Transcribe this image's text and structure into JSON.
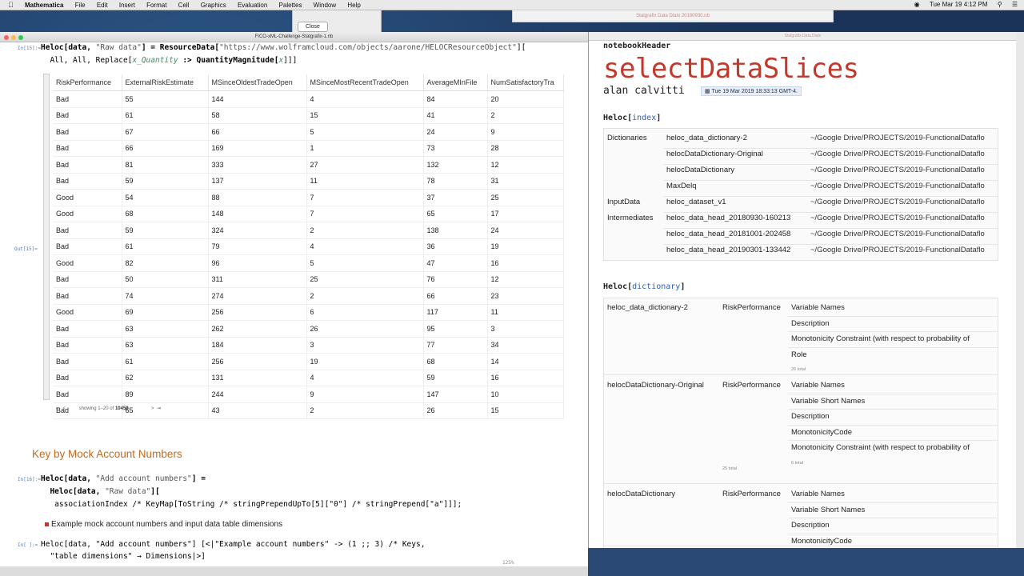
{
  "menubar": {
    "app": "Mathematica",
    "items": [
      "File",
      "Edit",
      "Insert",
      "Format",
      "Cell",
      "Graphics",
      "Evaluation",
      "Palettes",
      "Window",
      "Help"
    ],
    "clock": "Tue Mar 19  4:12 PM"
  },
  "bg_dialog": {
    "close_label": "Close"
  },
  "bg_window": {
    "title": "Statgrafix Data Dialo  20180930.nb"
  },
  "left_notebook": {
    "title": "FICO-xML-Challenge-Statgrafix-1.nb",
    "in15_label": "In[15]:=",
    "out15_label": "Out[15]=",
    "in16_label": "In[16]:=",
    "code15_line1_a": "Heloc[data, ",
    "code15_line1_str": "\"Raw data\"",
    "code15_line1_b": "] = ResourceData[",
    "code15_line1_url": "\"https://www.wolframcloud.com/objects/aarone/HELOCResourceObject\"",
    "code15_line1_c": "][",
    "code15_line2_a": "  All, All, Replace[",
    "code15_line2_it": "x_Quantity",
    "code15_line2_b": " :> QuantityMagnitude[",
    "code15_line2_it2": "x",
    "code15_line2_c": "]]]",
    "table": {
      "columns": [
        "RiskPerformance",
        "ExternalRiskEstimate",
        "MSinceOldestTradeOpen",
        "MSinceMostRecentTradeOpen",
        "AverageMInFile",
        "NumSatisfactoryTra"
      ],
      "rows": [
        [
          "Bad",
          "55",
          "144",
          "4",
          "84",
          "20"
        ],
        [
          "Bad",
          "61",
          "58",
          "15",
          "41",
          "2"
        ],
        [
          "Bad",
          "67",
          "66",
          "5",
          "24",
          "9"
        ],
        [
          "Bad",
          "66",
          "169",
          "1",
          "73",
          "28"
        ],
        [
          "Bad",
          "81",
          "333",
          "27",
          "132",
          "12"
        ],
        [
          "Bad",
          "59",
          "137",
          "11",
          "78",
          "31"
        ],
        [
          "Good",
          "54",
          "88",
          "7",
          "37",
          "25"
        ],
        [
          "Good",
          "68",
          "148",
          "7",
          "65",
          "17"
        ],
        [
          "Bad",
          "59",
          "324",
          "2",
          "138",
          "24"
        ],
        [
          "Bad",
          "61",
          "79",
          "4",
          "36",
          "19"
        ],
        [
          "Good",
          "82",
          "96",
          "5",
          "47",
          "16"
        ],
        [
          "Bad",
          "50",
          "311",
          "25",
          "76",
          "12"
        ],
        [
          "Bad",
          "74",
          "274",
          "2",
          "66",
          "23"
        ],
        [
          "Good",
          "69",
          "256",
          "6",
          "117",
          "11"
        ],
        [
          "Bad",
          "63",
          "262",
          "26",
          "95",
          "3"
        ],
        [
          "Bad",
          "63",
          "184",
          "3",
          "77",
          "34"
        ],
        [
          "Bad",
          "61",
          "256",
          "19",
          "68",
          "14"
        ],
        [
          "Bad",
          "62",
          "131",
          "4",
          "59",
          "16"
        ],
        [
          "Bad",
          "89",
          "244",
          "9",
          "147",
          "10"
        ],
        [
          "Bad",
          "65",
          "43",
          "2",
          "26",
          "15"
        ]
      ],
      "paging_prefix": "showing 1–20 of ",
      "paging_total": "10459"
    },
    "section_title": "Key by Mock Account Numbers",
    "code16_line1_a": "Heloc[data, ",
    "code16_line1_str": "\"Add account numbers\"",
    "code16_line1_b": "] =",
    "code16_line2_a": "  Heloc[data, ",
    "code16_line2_str": "\"Raw data\"",
    "code16_line2_b": "][",
    "code16_line3": "   associationIndex /* KeyMap[ToString /* stringPrependUpTo[5][\"0\"] /* stringPrepend[\"a\"]]];",
    "bullet_text": "Example mock account numbers and input data table dimensions",
    "code17_label": "In[ ]:=",
    "code17_line1": "Heloc[data, \"Add account numbers\"] [<|\"Example account numbers\" -> (1 ;; 3) /* Keys,",
    "code17_line2": "  \"table dimensions\" → Dimensions|>]",
    "zoom": "125%"
  },
  "right_notebook": {
    "title": "Statgrafix Data Dialo",
    "notebook_header": "notebookHeader",
    "big_title": "selectDataSlices",
    "author": "alan calvitti",
    "date": "Tue 19 Mar 2019 18:33:13 GMT-4.",
    "index_head_a": "Heloc[",
    "index_head_n": "index",
    "index_head_b": "]",
    "index_rows": [
      {
        "group": "Dictionaries",
        "name": "heloc_data_dictionary-2",
        "path": "~/Google Drive/PROJECTS/2019-FunctionalDataflo"
      },
      {
        "group": "",
        "name": "helocDataDictionary-Original",
        "path": "~/Google Drive/PROJECTS/2019-FunctionalDataflo"
      },
      {
        "group": "",
        "name": "helocDataDictionary",
        "path": "~/Google Drive/PROJECTS/2019-FunctionalDataflo"
      },
      {
        "group": "",
        "name": "MaxDelq",
        "path": "~/Google Drive/PROJECTS/2019-FunctionalDataflo"
      },
      {
        "group": "InputData",
        "name": "heloc_dataset_v1",
        "path": "~/Google Drive/PROJECTS/2019-FunctionalDataflo"
      },
      {
        "group": "Intermediates",
        "name": "heloc_data_head_20180930-160213",
        "path": "~/Google Drive/PROJECTS/2019-FunctionalDataflo"
      },
      {
        "group": "",
        "name": "heloc_data_head_20181001-202458",
        "path": "~/Google Drive/PROJECTS/2019-FunctionalDataflo"
      },
      {
        "group": "",
        "name": "heloc_data_head_20190301-133442",
        "path": "~/Google Drive/PROJECTS/2019-FunctionalDataflo"
      }
    ],
    "dict_head_a": "Heloc[",
    "dict_head_n": "dictionary",
    "dict_head_b": "]",
    "dict_groups": [
      {
        "name": "heloc_data_dictionary-2",
        "key": "RiskPerformance",
        "fields": [
          "Variable Names",
          "Description",
          "Monotonicity Constraint (with respect to probability of",
          "Role"
        ],
        "total": "26 total"
      },
      {
        "name": "helocDataDictionary-Original",
        "key": "RiskPerformance",
        "fields": [
          "Variable Names",
          "Variable Short Names",
          "Description",
          "MonotonicityCode",
          "Monotonicity Constraint (with respect to probability of"
        ],
        "total": "6 total"
      },
      {
        "name": "helocDataDictionary",
        "key": "RiskPerformance",
        "fields": [
          "Variable Names",
          "Variable Short Names",
          "Description",
          "MonotonicityCode"
        ],
        "total": ""
      }
    ],
    "between_total": "25 total"
  }
}
